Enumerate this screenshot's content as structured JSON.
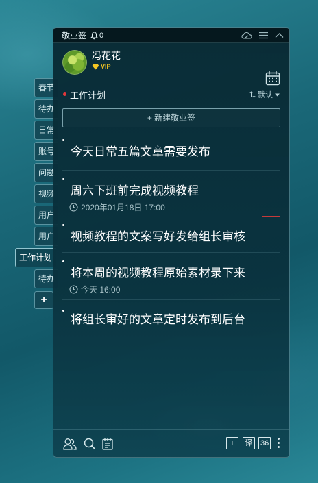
{
  "titlebar": {
    "app_title": "敬业签",
    "notification_count": "0",
    "icons": [
      "bell-icon",
      "cloud-icon",
      "menu-icon",
      "collapse-icon"
    ]
  },
  "user": {
    "name": "冯花花",
    "badge": "VIP"
  },
  "side_tabs": [
    {
      "label": "春节"
    },
    {
      "label": "待办"
    },
    {
      "label": "日常"
    },
    {
      "label": "账号"
    },
    {
      "label": "问题"
    },
    {
      "label": "视频"
    },
    {
      "label": "用户"
    },
    {
      "label": "用户"
    },
    {
      "label": "工作计划",
      "active": true
    },
    {
      "label": "待办"
    }
  ],
  "side_add_label": "+",
  "section": {
    "title": "工作计划",
    "sort_label": "默认"
  },
  "new_note_label": "+ 新建敬业签",
  "notes": [
    {
      "text": "今天日常五篇文章需要发布",
      "time": ""
    },
    {
      "text": "周六下班前完成视频教程",
      "time": "2020年01月18日 17:00"
    },
    {
      "text": "视频教程的文案写好发给组长审核",
      "time": ""
    },
    {
      "text": "将本周的视频教程原始素材录下来",
      "time": "今天 16:00"
    },
    {
      "text": "将组长审好的文章定时发布到后台",
      "time": ""
    }
  ],
  "bottom_bar": {
    "add_label": "+",
    "translate_label": "译",
    "count_label": "36"
  },
  "colors": {
    "accent_red": "#e0373b",
    "vip_gold": "#f3c623",
    "panel_bg": "#0a3340"
  }
}
